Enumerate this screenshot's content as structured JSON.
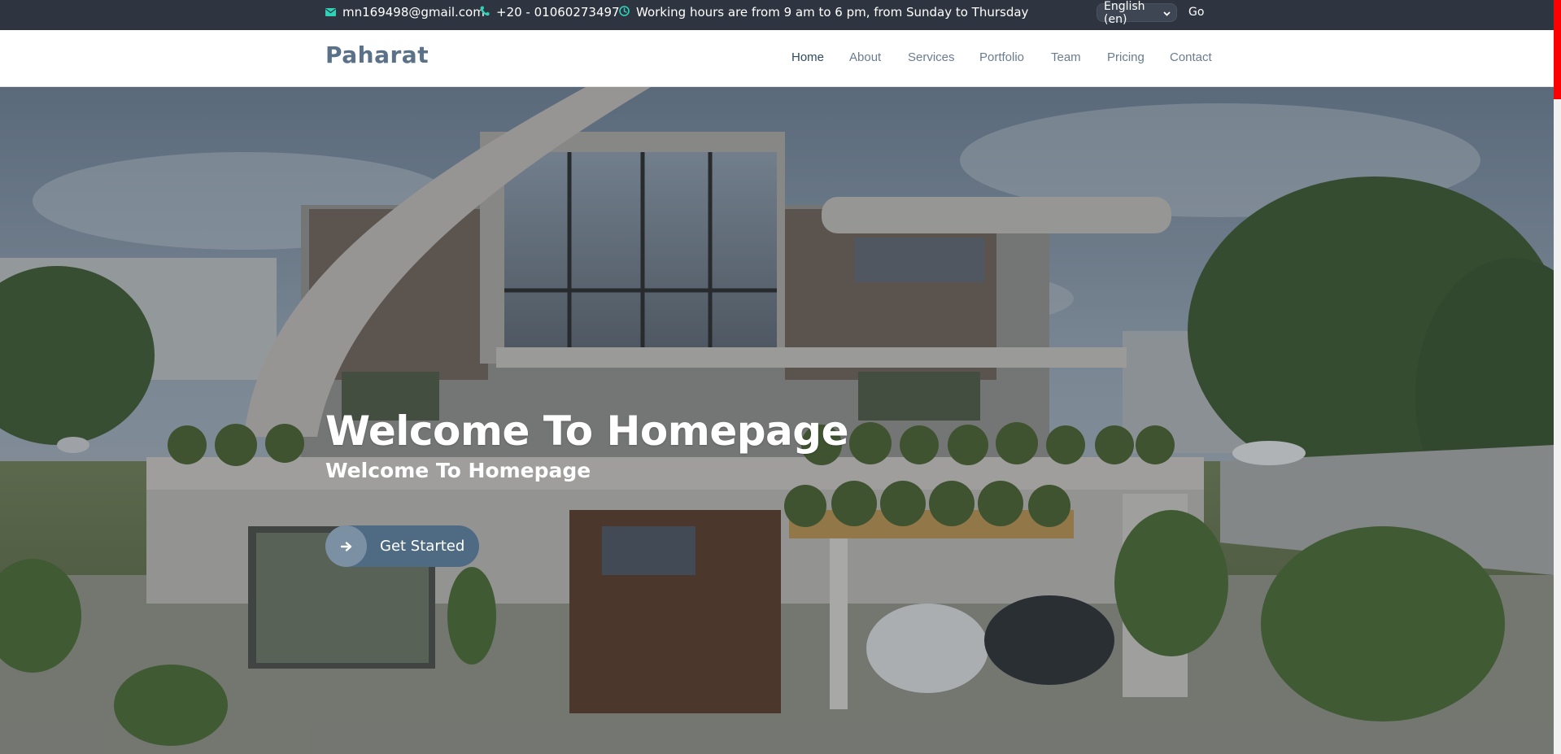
{
  "topbar": {
    "email": "mn169498@gmail.com",
    "phone": "+20 - 01060273497",
    "hours": "Working hours are from 9 am to 6 pm, from Sunday to Thursday",
    "language_selected": "English (en)",
    "go_label": "Go",
    "icon_color": "#2ed3b7"
  },
  "header": {
    "logo": "Paharat",
    "nav": [
      {
        "label": "Home",
        "active": true
      },
      {
        "label": "About"
      },
      {
        "label": "Services"
      },
      {
        "label": "Portfolio"
      },
      {
        "label": "Team"
      },
      {
        "label": "Pricing"
      },
      {
        "label": "Contact"
      }
    ]
  },
  "hero": {
    "title": "Welcome To Homepage",
    "subtitle": "Welcome To Homepage",
    "cta_label": "Get Started"
  },
  "colors": {
    "topbar_bg": "#2e3440",
    "logo": "#5a7187",
    "nav_active": "#2f4a63",
    "cta_bg": "#4f6b83",
    "scroll_thumb": "#ff0000"
  },
  "icons": [
    "envelope-icon",
    "phone-icon",
    "clock-icon",
    "chevron-down-icon",
    "arrow-right-icon"
  ]
}
